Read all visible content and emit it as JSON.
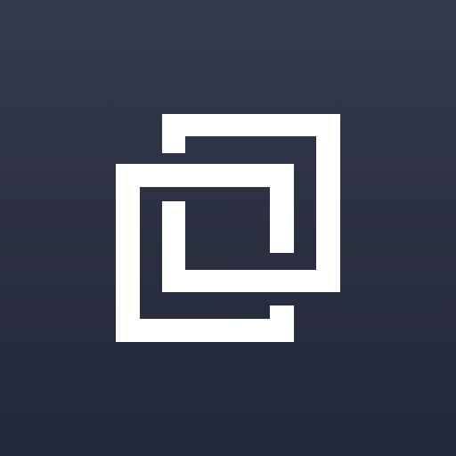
{
  "app_icon": {
    "icon": "interlocking-squares-logo-icon",
    "colors": {
      "background_top": "#353a4f",
      "background_bottom": "#22273a",
      "mark": "#ffffff"
    }
  }
}
